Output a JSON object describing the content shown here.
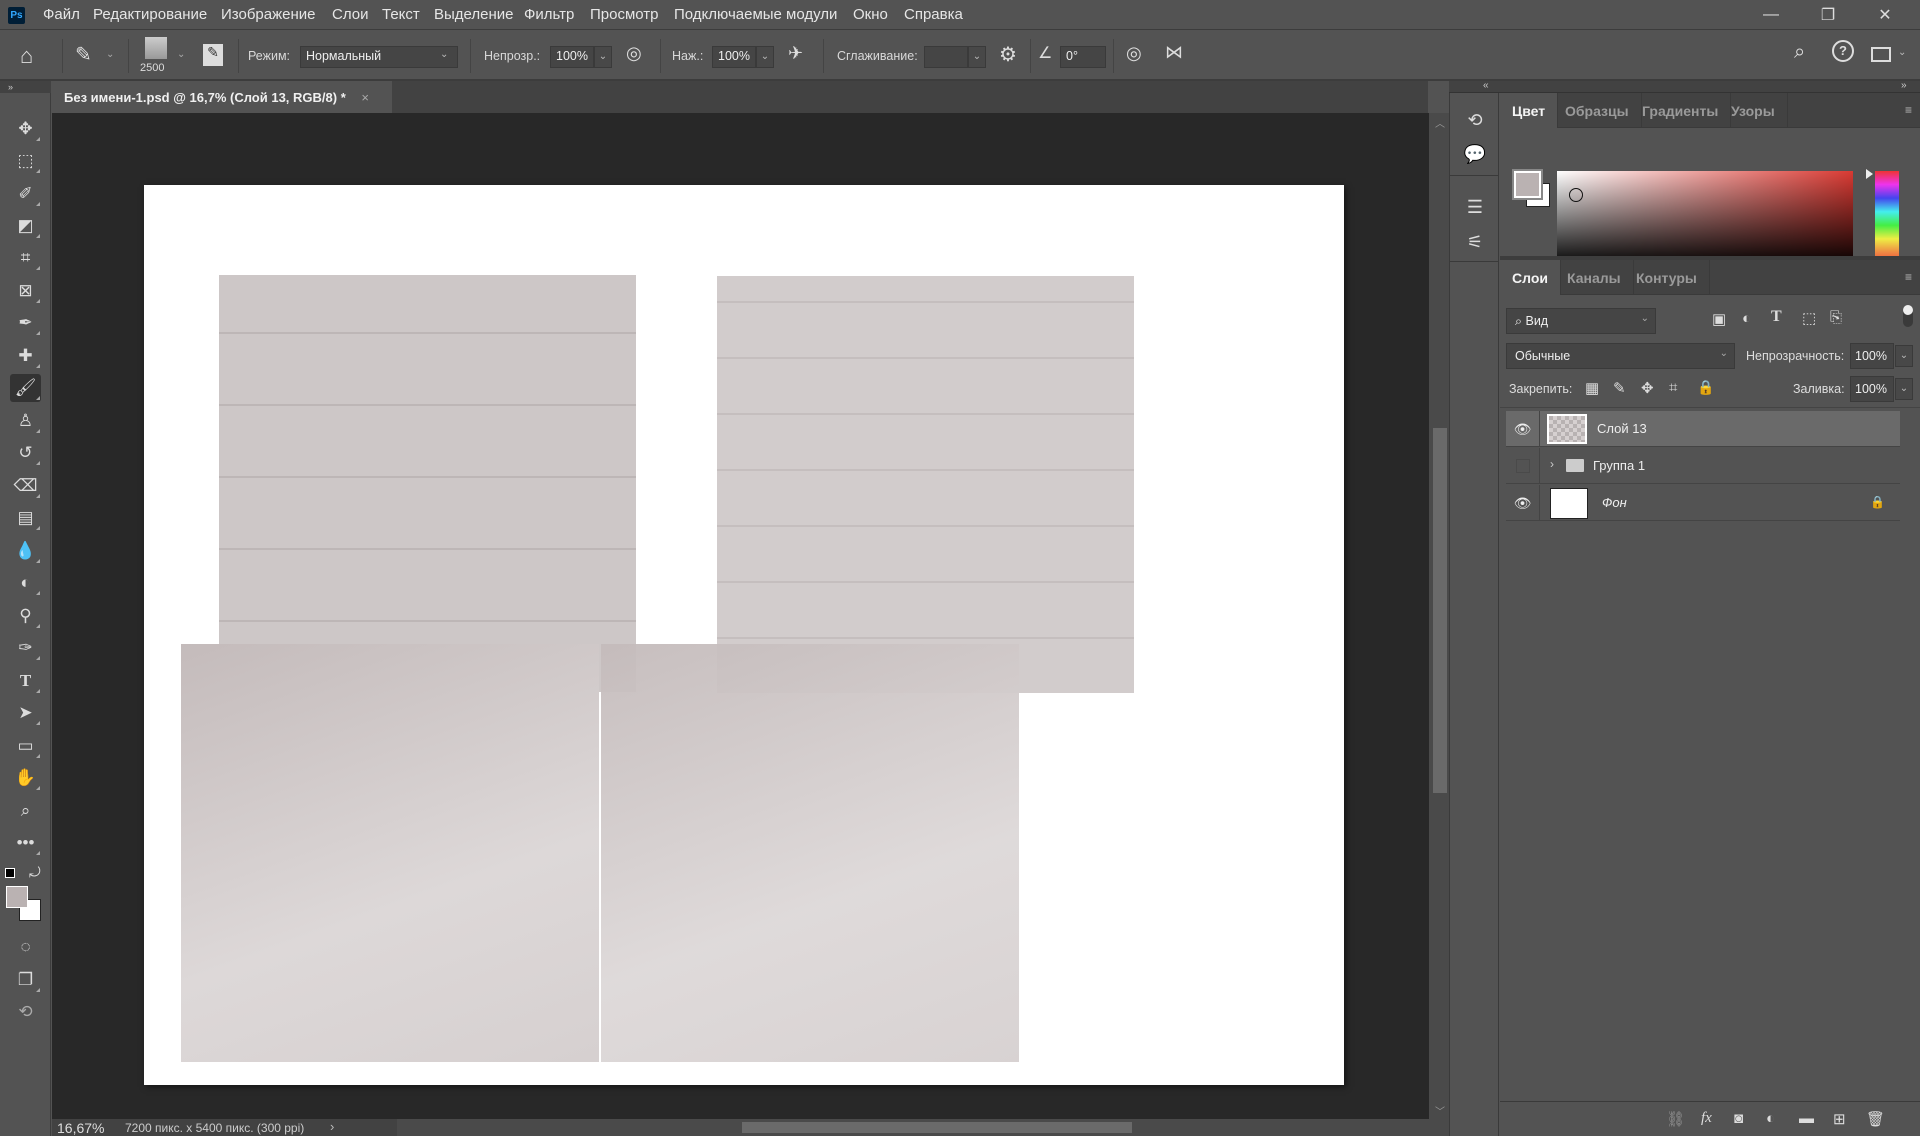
{
  "app": {
    "logo": "Ps"
  },
  "menu": [
    "Файл",
    "Редактирование",
    "Изображение",
    "Слои",
    "Текст",
    "Выделение",
    "Фильтр",
    "Просмотр",
    "Подключаемые модули",
    "Окно",
    "Справка"
  ],
  "window_controls": {
    "minimize": "—",
    "restore": "❐",
    "close": "✕"
  },
  "options": {
    "brush_size": "2500",
    "mode_label": "Режим:",
    "mode_value": "Нормальный",
    "opacity_label": "Непрозр.:",
    "opacity_value": "100%",
    "flow_label": "Наж.:",
    "flow_value": "100%",
    "smoothing_label": "Сглаживание:",
    "smoothing_value": "",
    "angle_value": "0°"
  },
  "document": {
    "tab_title": "Без имени-1.psd @ 16,7% (Слой 13, RGB/8) *",
    "close": "×"
  },
  "status": {
    "zoom": "16,67%",
    "info": "7200 пикс. x 5400 пикс. (300 ppi)",
    "arrow": "›"
  },
  "color_panel": {
    "tabs": [
      "Цвет",
      "Образцы",
      "Градиенты",
      "Узоры"
    ],
    "active_tab": 0,
    "foreground": "#bab2b2",
    "background": "#ffffff"
  },
  "layers_panel": {
    "tabs": [
      "Слои",
      "Каналы",
      "Контуры"
    ],
    "active_tab": 0,
    "filter_label": "Вид",
    "blend_mode": "Обычные",
    "opacity_label": "Непрозрачность:",
    "opacity_value": "100%",
    "lock_label": "Закрепить:",
    "fill_label": "Заливка:",
    "fill_value": "100%",
    "layers": [
      {
        "name": "Слой 13",
        "visible": true,
        "selected": true,
        "type": "pixel"
      },
      {
        "name": "Группа 1",
        "visible": false,
        "selected": false,
        "type": "group"
      },
      {
        "name": "Фон",
        "visible": true,
        "selected": false,
        "type": "background",
        "locked": true
      }
    ]
  }
}
